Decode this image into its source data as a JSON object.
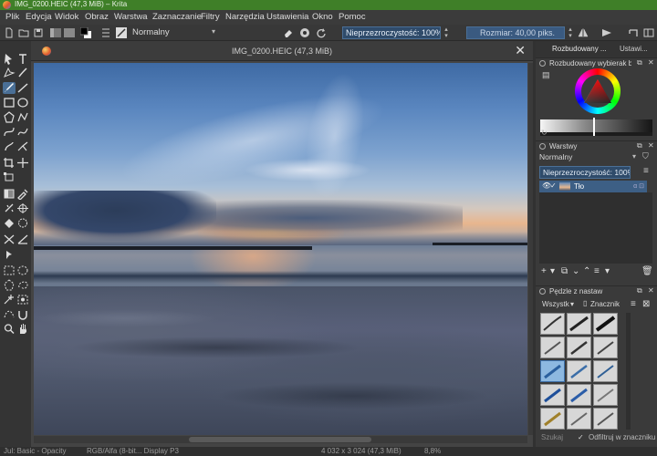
{
  "window": {
    "title": "IMG_0200.HEIC (47,3 MiB) – Krita"
  },
  "menu": [
    "Plik",
    "Edycja",
    "Widok",
    "Obraz",
    "Warstwa",
    "Zaznaczanie",
    "Filtry",
    "Narzędzia",
    "Ustawienia",
    "Okno",
    "Pomoc"
  ],
  "toolbar": {
    "blend_mode": "Normalny",
    "opacity": "Nieprzezroczystość: 100%",
    "size": "Rozmiar: 40,00 piks."
  },
  "document": {
    "tab_title": "IMG_0200.HEIC (47,3 MiB)"
  },
  "dock": {
    "tabs": [
      "Rozbudowany ...",
      "Ustawi..."
    ],
    "color_panel_title": "Rozbudowany wybierak b...",
    "layers_panel_title": "Warstwy",
    "layers_blend": "Normalny",
    "layers_opacity": "Nieprzezroczystość: 100%",
    "layers": [
      {
        "name": "Tło"
      }
    ],
    "brush_panel_title": "Pędzle z nastaw",
    "brush_filter": "Wszystk",
    "brush_tags": "Znacznik",
    "brush_search_placeholder": "Szukaj",
    "brush_filter_tag": "Odfiltruj w znaczniku"
  },
  "status": {
    "left": "Jul: Basic - Opacity",
    "color": "RGB/Alfa (8-bit... Display P3",
    "dims": "4 032 x 3 024 (47,3 MiB)",
    "zoom": "8,8%"
  },
  "colors": {
    "title_bar": "#3f7f28",
    "accent": "#4a6f96",
    "selected_layer": "#3d5f85"
  }
}
